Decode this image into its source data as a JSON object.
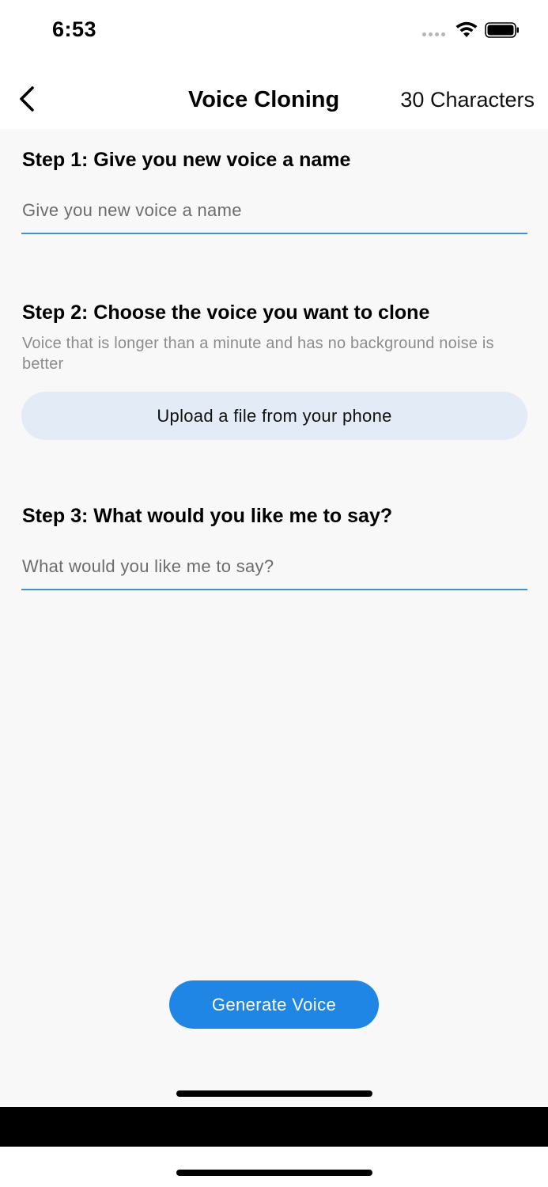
{
  "status_bar": {
    "time": "6:53"
  },
  "nav": {
    "title": "Voice Cloning",
    "right_text": "30 Characters"
  },
  "step1": {
    "title": "Step 1: Give you new voice a name",
    "input_placeholder": "Give you new voice a name",
    "input_value": ""
  },
  "step2": {
    "title": "Step 2: Choose the voice you want to clone",
    "hint": "Voice that is longer than a minute and has no background noise is better",
    "upload_label": "Upload a file from your phone"
  },
  "step3": {
    "title": "Step 3: What would you like me to say?",
    "input_placeholder": "What would you like me to say?",
    "input_value": ""
  },
  "generate_label": "Generate Voice",
  "colors": {
    "accent": "#1f86e6",
    "underline": "#3f8ed8",
    "upload_bg": "#e2ebf6",
    "content_bg": "#f8f8f8"
  },
  "icons": {
    "back": "chevron-left-icon",
    "wifi": "wifi-icon",
    "battery": "battery-icon",
    "signal": "signal-icon"
  }
}
